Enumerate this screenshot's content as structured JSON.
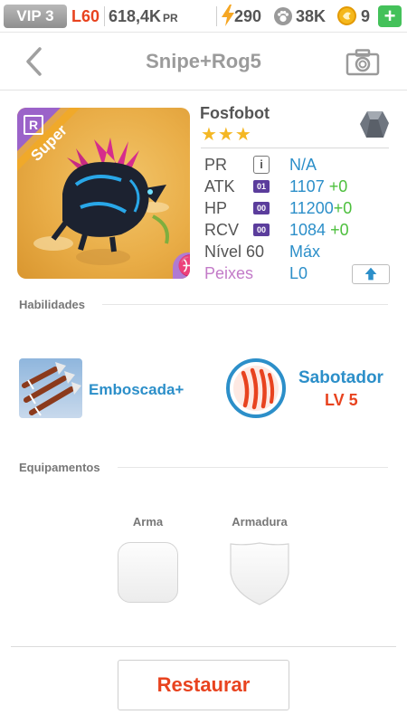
{
  "topbar": {
    "vip": "VIP 3",
    "level": "L60",
    "pr_value": "618,4K",
    "pr_unit": "PR",
    "energy": "290",
    "food": "38K",
    "gems": "9",
    "plus": "+"
  },
  "header": {
    "title": "Snipe+Rog5",
    "back_icon": "chevron-left-icon",
    "camera_icon": "camera-icon"
  },
  "monster": {
    "rank": "R",
    "badge": "Super",
    "sign": "♓",
    "name": "Fosfobot",
    "stars": "★★★",
    "element_icon": "metal-element-icon",
    "stats": {
      "pr": {
        "label": "PR",
        "icon": "i",
        "value": "N/A"
      },
      "atk": {
        "label": "ATK",
        "chip": "01",
        "value": "1107",
        "bonus": "+0"
      },
      "hp": {
        "label": "HP",
        "chip": "00",
        "value": "11200",
        "bonus": "+0"
      },
      "rcv": {
        "label": "RCV",
        "chip": "00",
        "value": "1084",
        "bonus": "+0"
      },
      "level": {
        "label": "Nível 60",
        "value": "Máx"
      },
      "fish": {
        "label": "Peixes",
        "value": "L0"
      }
    }
  },
  "colors": {
    "accent_blue": "#2c8fc9",
    "accent_red": "#e8431f",
    "bonus_green": "#4cbf3c",
    "fish_purple": "#c37bc8"
  },
  "skills": {
    "label": "Habilidades",
    "items": [
      {
        "name": "Emboscada+",
        "icon": "ambush-arrows-icon"
      },
      {
        "name": "Sabotador",
        "level": "LV 5",
        "icon": "claw-marks-icon"
      }
    ]
  },
  "equipment": {
    "label": "Equipamentos",
    "weapon_label": "Arma",
    "armor_label": "Armadura"
  },
  "actions": {
    "restore": "Restaurar"
  }
}
